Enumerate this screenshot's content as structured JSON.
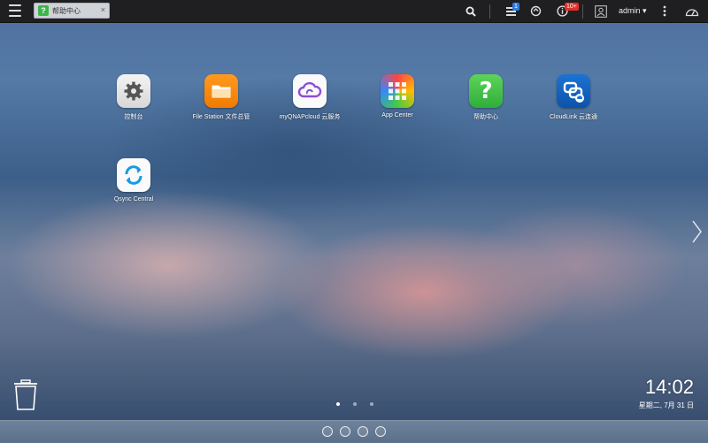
{
  "topbar": {
    "tab": {
      "label": "帮助中心",
      "icon": "help-icon",
      "close": "×"
    },
    "notifications_badge": "1",
    "info_badge": "10+",
    "user": "admin ▾",
    "icons": [
      "menu-icon",
      "search-icon",
      "task-icon",
      "sync-icon",
      "info-icon",
      "user-icon",
      "more-icon",
      "dashboard-icon"
    ]
  },
  "apps": [
    {
      "label": "控制台",
      "icon": "gear-icon"
    },
    {
      "label": "File Station 文件总管",
      "icon": "folder-icon"
    },
    {
      "label": "myQNAPcloud 云服务",
      "icon": "cloud-icon"
    },
    {
      "label": "App Center",
      "icon": "app-grid-icon"
    },
    {
      "label": "帮助中心",
      "icon": "help-icon"
    },
    {
      "label": "CloudLink 云连通",
      "icon": "cloudlink-icon"
    },
    {
      "label": "Qsync Central",
      "icon": "sync-icon"
    }
  ],
  "clock": {
    "time": "14:02",
    "date": "星期二, 7月 31 日"
  },
  "pager": {
    "pages": 3,
    "active": 1
  },
  "colors": {
    "topbar": "#1f1f21",
    "help_green": "#3db54a",
    "info_badge": "#e0302a",
    "task_badge": "#2f7de1"
  }
}
